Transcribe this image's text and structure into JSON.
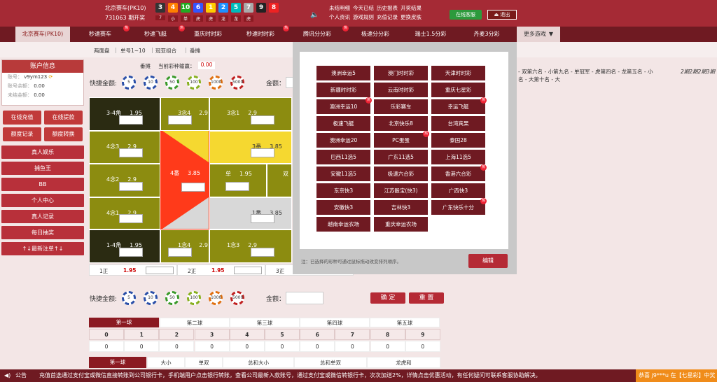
{
  "header": {
    "lottery": "北京赛车(PK10)",
    "issue": "731063 期开奖",
    "balls": [
      "3",
      "4",
      "10",
      "6",
      "1",
      "2",
      "5",
      "7",
      "9",
      "8"
    ],
    "ball_colors": [
      "#333333",
      "#ff7f00",
      "#22aa22",
      "#3355ff",
      "#ffcc00",
      "#1e90ff",
      "#00bbbb",
      "#aaaaaa",
      "#222222",
      "#ee2222"
    ],
    "ball_labels": [
      "7",
      "小",
      "单",
      "虎",
      "虎",
      "龙",
      "龙",
      "虎"
    ],
    "links": [
      "未结明细",
      "今天已结",
      "历史报表",
      "开奖结果",
      "个人资讯",
      "游戏规则",
      "充值记录",
      "更换皮肤"
    ],
    "online_btn": "在线客服",
    "logout": "退出"
  },
  "nav": [
    "北京赛车(PK10)",
    "秒速赛车",
    "秒速飞艇",
    "重庆时时彩",
    "秒速时时彩",
    "腾讯分分彩",
    "极速分分彩",
    "瑞士1.5分彩",
    "丹麦3分彩",
    "更多游戏"
  ],
  "subnav": [
    "两面盘",
    "单号1~10",
    "冠亚组合",
    "番摊"
  ],
  "panel": {
    "title": "账户信息",
    "account_label": "账号：",
    "account": "v9ym123",
    "balance_label": "账号余额：",
    "balance": "0.00",
    "unsettled_label": "未结金额：",
    "unsettled": "0.00"
  },
  "side_btns": [
    "在线充值",
    "在线提款",
    "额度记录",
    "额度转换"
  ],
  "side_wide": [
    "真人娱乐",
    "捕鱼王",
    "BB",
    "个人中心",
    "真人记录",
    "每日抽奖",
    "↑↓最新注单↑↓"
  ],
  "bet": {
    "mode": "番摊",
    "result_label": "当前彩种输赢：",
    "result": "0.00",
    "quick_amount": "快捷金额:",
    "amount_label": "金额：",
    "chips": [
      "5",
      "10",
      "50",
      "100",
      "1000",
      "5000"
    ],
    "confirm": "确 定",
    "reset": "重 置"
  },
  "cells": [
    {
      "label": "3-4角",
      "odds": "1.95"
    },
    {
      "label": "3念4",
      "odds": "2.9"
    },
    {
      "label": "3念1",
      "odds": "2.9"
    },
    {
      "label": "4念3",
      "odds": "2.9"
    },
    {
      "label": "3番",
      "odds": "3.85"
    },
    {
      "label": "4念2",
      "odds": "2.9"
    },
    {
      "label": "4番",
      "odds": "3.85"
    },
    {
      "label": "单",
      "odds": "1.95"
    },
    {
      "label": "双",
      "odds": ""
    },
    {
      "label": "4念1",
      "odds": "2.9"
    },
    {
      "label": "1番",
      "odds": "3.85"
    },
    {
      "label": "1-4角",
      "odds": "1.95"
    },
    {
      "label": "1念4",
      "odds": "2.9"
    },
    {
      "label": "1念3",
      "odds": "2.9"
    }
  ],
  "bottom_row": [
    {
      "label": "1正",
      "odds": "1.95"
    },
    {
      "label": "2正",
      "odds": "1.95"
    },
    {
      "label": "3正",
      "odds": ""
    }
  ],
  "right_text": [
    "- 双第六名 - 小第九名 - 单冠军 - 虎第四名 - 龙第五名 - 小",
    "名 - 大第十名 - 大"
  ],
  "right_text2": "2期2期2期3期",
  "menu": {
    "games": [
      "澳洲幸运5",
      "澳门时时彩",
      "天津时时彩",
      "新疆时时彩",
      "云南时时彩",
      "重庆七星彩",
      "澳洲幸运10",
      "乐彩赛车",
      "幸运飞艇",
      "极速飞艇",
      "北京快乐8",
      "台湾宾果",
      "澳洲幸运20",
      "PC蛋蛋",
      "泰国28",
      "巴西11选5",
      "广东11选5",
      "上海11选5",
      "安徽11选5",
      "极速六合彩",
      "香港六合彩",
      "东京快3",
      "江苏骰宝(快3)",
      "广西快3",
      "安徽快3",
      "吉林快3",
      "广东快乐十分",
      "越南幸运农场",
      "重庆幸运农场"
    ],
    "hot": [
      6,
      8,
      13,
      20,
      26
    ],
    "note": "注：已选择的彩种可通过鼠标拖动改变排列顺序。",
    "edit": "编辑"
  },
  "table": {
    "tabs": [
      "第一球",
      "第二球",
      "第三球",
      "第四球",
      "第五球"
    ],
    "nums": [
      "0",
      "1",
      "2",
      "3",
      "4",
      "5",
      "6",
      "7",
      "8",
      "9"
    ],
    "vals": [
      "0",
      "0",
      "0",
      "0",
      "0",
      "0",
      "0",
      "0",
      "0",
      "0"
    ],
    "tabs2": [
      "第一球",
      "大小",
      "单双",
      "总和大小",
      "总和单双",
      "龙虎和"
    ]
  },
  "footer": {
    "label": "公告",
    "text": "充值首选通过支付宝或微信直接转账到公司银行卡，手机端用户点击银行转账，查看公司最新入款账号，通过支付宝或微信转银行卡，次次加送2%，详情点击优惠活动，有任何疑问可联系客服协助解决。",
    "right": "恭喜 j9***u 在【七星彩】中奖"
  }
}
